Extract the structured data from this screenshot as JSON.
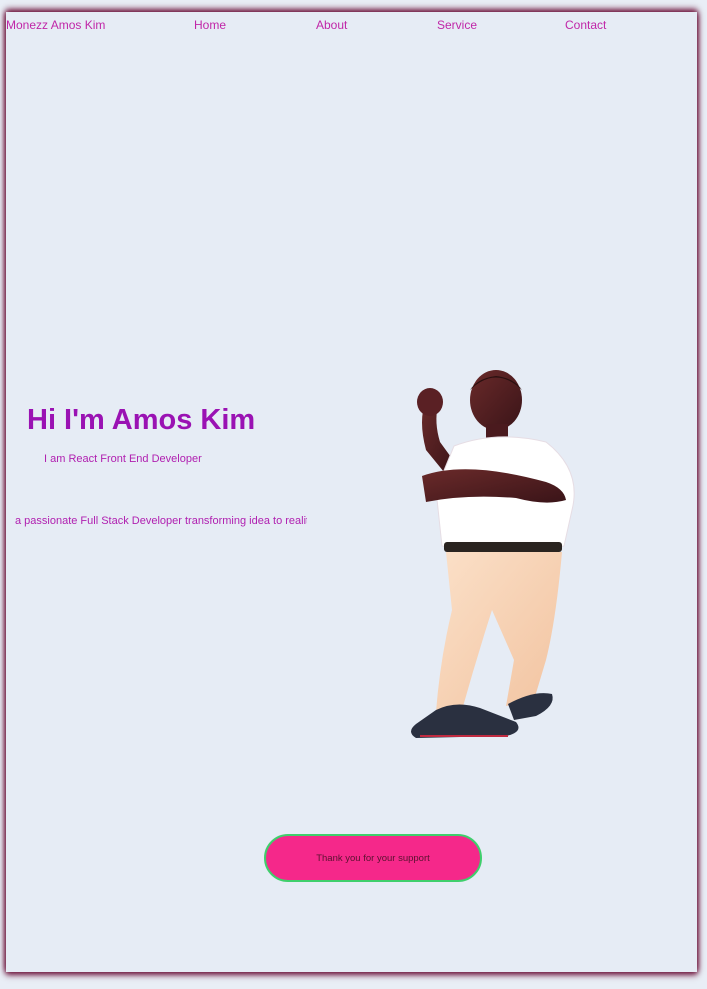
{
  "nav": {
    "brand": "Monezz Amos Kim",
    "links": [
      "Home",
      "About",
      "Service",
      "Contact"
    ]
  },
  "hero": {
    "title": "Hi I'm Amos Kim",
    "subtitle": "I am React Front End Developer",
    "description": "a passionate Full Stack Developer transforming idea to reality"
  },
  "portrait": {
    "icon": "person-photo-icon"
  },
  "cta": {
    "label": "Thank you for your support"
  },
  "colors": {
    "accent_text": "#9a12b3",
    "nav_text": "#c026a8",
    "button_bg": "#f5288a",
    "button_border": "#3fcf6c",
    "background": "#e6ecf5"
  }
}
